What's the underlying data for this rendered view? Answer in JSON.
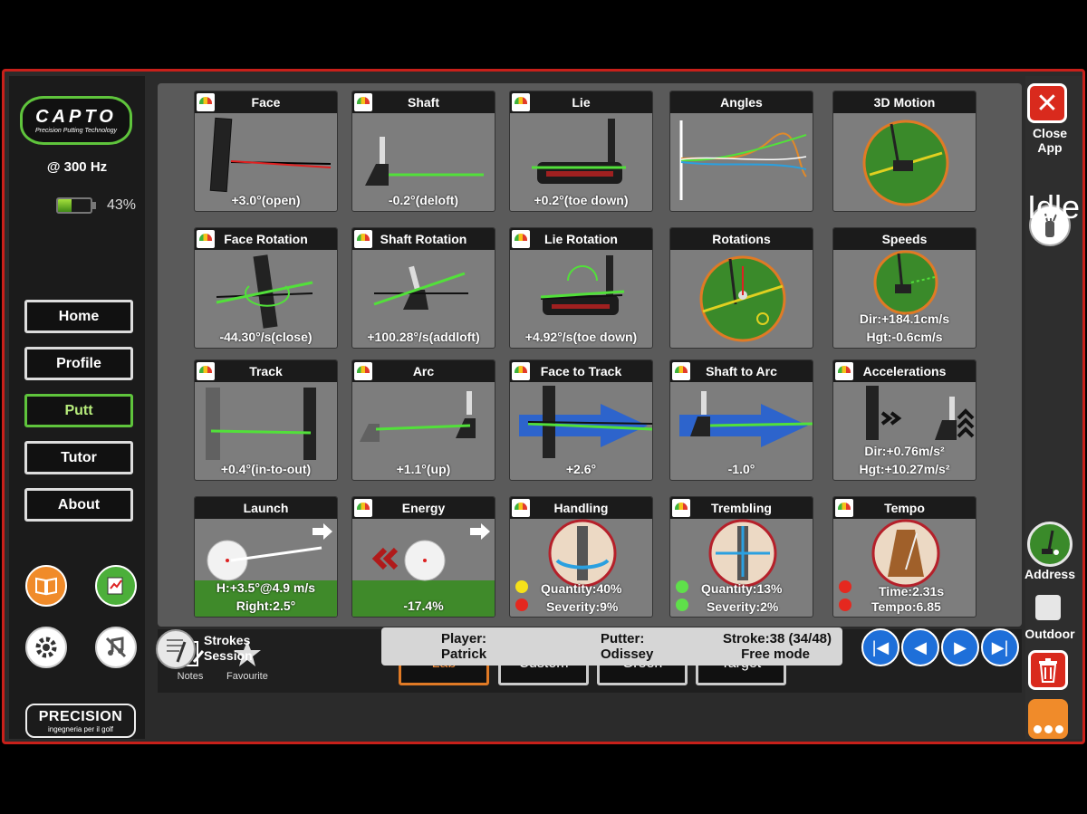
{
  "sidebar": {
    "logo_title": "CAPTO",
    "logo_subtitle": "Precision Putting Technology",
    "frequency": "@ 300 Hz",
    "battery_percent": "43%",
    "battery_level": 0.43,
    "nav": [
      "Home",
      "Profile",
      "Putt",
      "Tutor",
      "About"
    ],
    "active_nav": "Putt",
    "brand": "PRECISION",
    "brand_tagline": "ingegneria per il golf"
  },
  "tiles": [
    {
      "title": "Face",
      "value": "+3.0°(open)",
      "gauge": true
    },
    {
      "title": "Shaft",
      "value": "-0.2°(deloft)",
      "gauge": true
    },
    {
      "title": "Lie",
      "value": "+0.2°(toe down)",
      "gauge": true
    },
    {
      "title": "Angles",
      "value": "",
      "gauge": false
    },
    {
      "title": "3D Motion",
      "value": "",
      "gauge": false
    },
    {
      "title": "Face Rotation",
      "value": "-44.30°/s(close)",
      "gauge": true
    },
    {
      "title": "Shaft Rotation",
      "value": "+100.28°/s(addloft)",
      "gauge": true
    },
    {
      "title": "Lie Rotation",
      "value": "+4.92°/s(toe down)",
      "gauge": true
    },
    {
      "title": "Rotations",
      "value": "",
      "gauge": false
    },
    {
      "title": "Speeds",
      "value": "Dir:+184.1cm/s",
      "value2": "Hgt:-0.6cm/s",
      "gauge": false
    },
    {
      "title": "Track",
      "value": "+0.4°(in-to-out)",
      "gauge": true
    },
    {
      "title": "Arc",
      "value": "+1.1°(up)",
      "gauge": true
    },
    {
      "title": "Face to Track",
      "value": "+2.6°",
      "gauge": true
    },
    {
      "title": "Shaft to Arc",
      "value": "-1.0°",
      "gauge": true
    },
    {
      "title": "Accelerations",
      "value": "Dir:+0.76m/s²",
      "value2": "Hgt:+10.27m/s²",
      "gauge": true
    },
    {
      "title": "Launch",
      "value": "H:+3.5°@4.9 m/s",
      "value2": "Right:2.5°",
      "gauge": false
    },
    {
      "title": "Energy",
      "value": "-17.4%",
      "gauge": true
    },
    {
      "title": "Handling",
      "stat1": "Quantity:40%",
      "stat2": "Severity:9%",
      "dot1": "#f5e11a",
      "dot2": "#e5281f",
      "gauge": true
    },
    {
      "title": "Trembling",
      "stat1": "Quantity:13%",
      "stat2": "Severity:2%",
      "dot1": "#5fe04a",
      "dot2": "#5fe04a",
      "gauge": true
    },
    {
      "title": "Tempo",
      "stat1": "Time:2.31s",
      "stat2": "Tempo:6.85",
      "dot1": "#e5281f",
      "dot2": "#e5281f",
      "gauge": true
    }
  ],
  "toolbar": {
    "notes_label": "Notes",
    "favourite_label": "Favourite",
    "modes": [
      "Lab",
      "Custom",
      "Green",
      "Target"
    ],
    "active_mode": "Lab"
  },
  "status": {
    "session_line1": "Strokes",
    "session_line2": "Session",
    "player_label": "Player:",
    "player_name": "Patrick",
    "putter_label": "Putter:",
    "putter_name": "Odissey",
    "stroke": "Stroke:38 (34/48)",
    "mode": "Free mode"
  },
  "right": {
    "close_label": "Close",
    "close_label2": "App",
    "state": "Idle",
    "address_label": "Address",
    "outdoor_label": "Outdoor"
  },
  "colors": {
    "frame": "#c8201a",
    "accent_green": "#5fc43c",
    "accent_orange": "#e07a25",
    "nav_blue": "#1e6fd9"
  }
}
